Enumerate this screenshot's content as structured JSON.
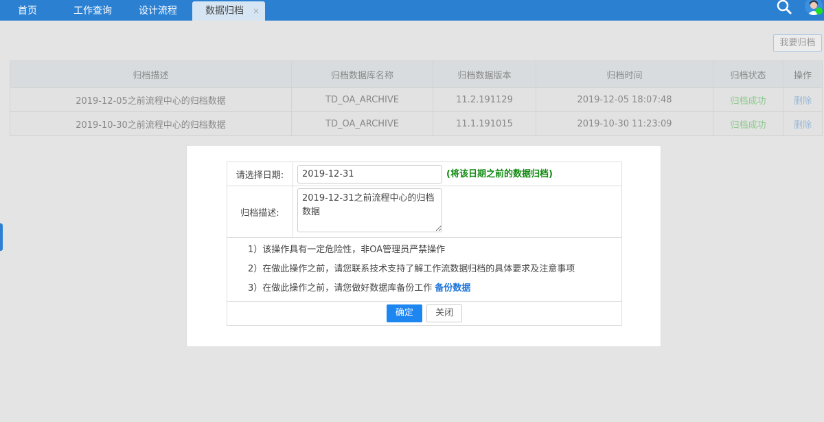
{
  "tabs": [
    {
      "label": "首页"
    },
    {
      "label": "工作查询"
    },
    {
      "label": "设计流程"
    },
    {
      "label": "数据归档",
      "close": "×"
    }
  ],
  "toolbar": {
    "archive_label": "我要归档"
  },
  "table": {
    "headers": [
      "归档描述",
      "归档数据库名称",
      "归档数据版本",
      "归档时间",
      "归档状态",
      "操作"
    ],
    "rows": [
      [
        "2019-12-05之前流程中心的归档数据",
        "TD_OA_ARCHIVE",
        "11.2.191129",
        "2019-12-05 18:07:48",
        "归档成功",
        "删除"
      ],
      [
        "2019-10-30之前流程中心的归档数据",
        "TD_OA_ARCHIVE",
        "11.1.191015",
        "2019-10-30 11:23:09",
        "归档成功",
        "删除"
      ]
    ]
  },
  "dialog": {
    "date_label": "请选择日期:",
    "date_value": "2019-12-31",
    "date_hint": "(将该日期之前的数据归档)",
    "desc_label": "归档描述:",
    "desc_value": "2019-12-31之前流程中心的归档数据",
    "warnings": [
      "1）该操作具有一定危险性，非OA管理员严禁操作",
      "2）在做此操作之前，请您联系技术支持了解工作流数据归档的具体要求及注意事项",
      "3）在做此操作之前，请您做好数据库备份工作 "
    ],
    "backup_link": "备份数据",
    "confirm": "确定",
    "close": "关闭"
  }
}
